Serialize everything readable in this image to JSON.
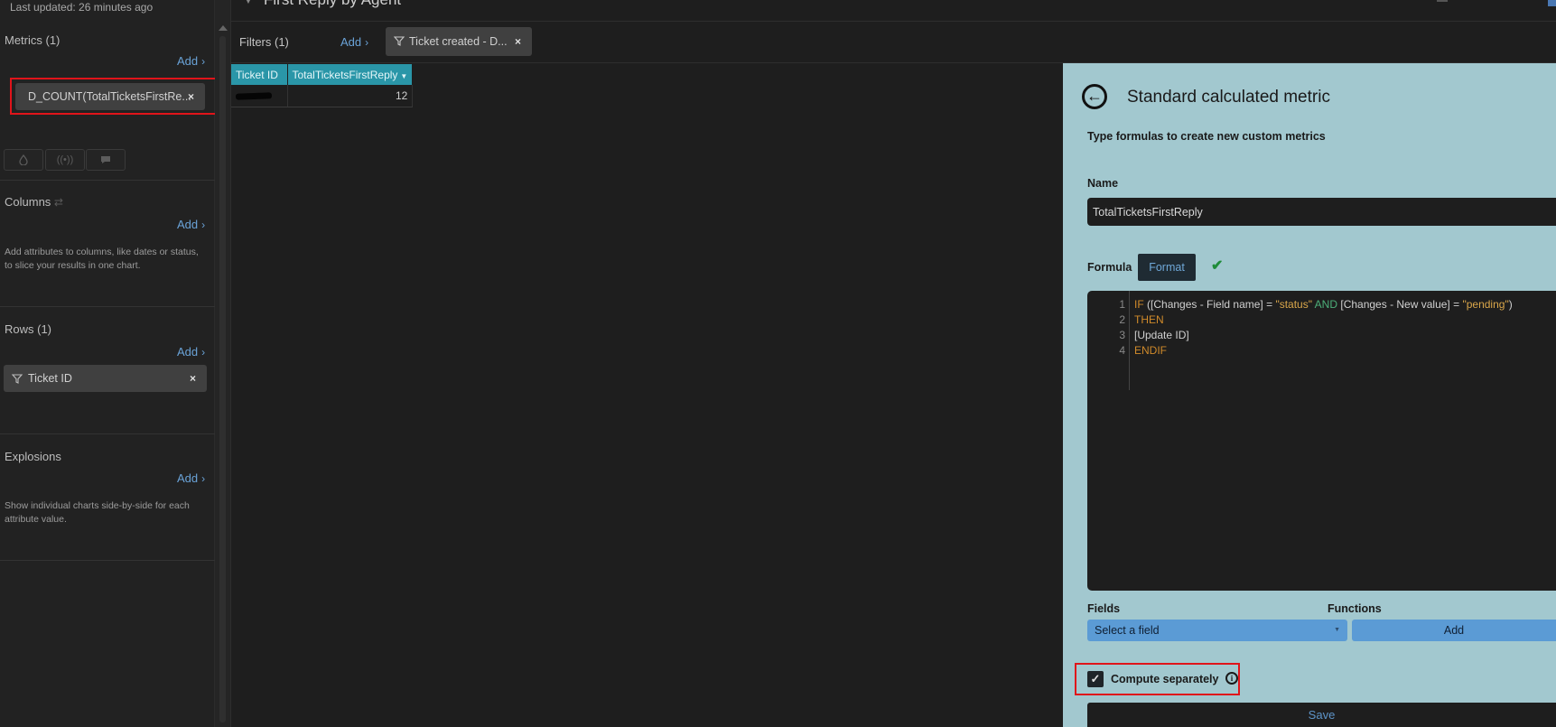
{
  "header": {
    "title": "First Reply by Agent",
    "last_updated": "Last updated: 26 minutes ago"
  },
  "sidebar": {
    "metrics": {
      "title": "Metrics (1)",
      "add": "Add",
      "items": [
        {
          "label": "D_COUNT(TotalTicketsFirstRe..."
        }
      ]
    },
    "columns": {
      "title": "Columns",
      "add": "Add",
      "hint": "Add attributes to columns, like dates or status, to slice your results in one chart."
    },
    "rows": {
      "title": "Rows (1)",
      "add": "Add",
      "items": [
        {
          "label": "Ticket ID"
        }
      ]
    },
    "explosions": {
      "title": "Explosions",
      "add": "Add",
      "hint": "Show individual charts side-by-side for each attribute value."
    }
  },
  "filters": {
    "title": "Filters (1)",
    "add": "Add",
    "items": [
      {
        "label": "Ticket created - D..."
      }
    ]
  },
  "table": {
    "headers": [
      "Ticket ID",
      "TotalTicketsFirstReply"
    ],
    "rows": [
      {
        "value": "12"
      }
    ]
  },
  "panel": {
    "title": "Standard calculated metric",
    "subtitle": "Type formulas to create new custom metrics",
    "name_label": "Name",
    "name_value": "TotalTicketsFirstReply",
    "formula_label": "Formula",
    "format_button": "Format",
    "formula_lines": {
      "l1": {
        "num": "1",
        "if": "IF",
        "p1": "(",
        "f1": "[Changes - Field name]",
        "eq1": "=",
        "s1": "\"status\"",
        "and": "AND",
        "f2": "[Changes - New value]",
        "eq2": "=",
        "s2": "\"pending\"",
        "p2": ")"
      },
      "l2": {
        "num": "2",
        "then": "THEN"
      },
      "l3": {
        "num": "3",
        "text": "[Update ID]"
      },
      "l4": {
        "num": "4",
        "endif": "ENDIF"
      }
    },
    "fields_label": "Fields",
    "fields_placeholder": "Select a field",
    "functions_label": "Functions",
    "add_button": "Add",
    "compute_separately": "Compute separately",
    "compute_checked": true,
    "save_button": "Save"
  },
  "colors": {
    "accent": "#2a96a8",
    "panel_bg": "#a2c8cf",
    "link": "#6aa3d8",
    "highlight": "#e0141a"
  }
}
